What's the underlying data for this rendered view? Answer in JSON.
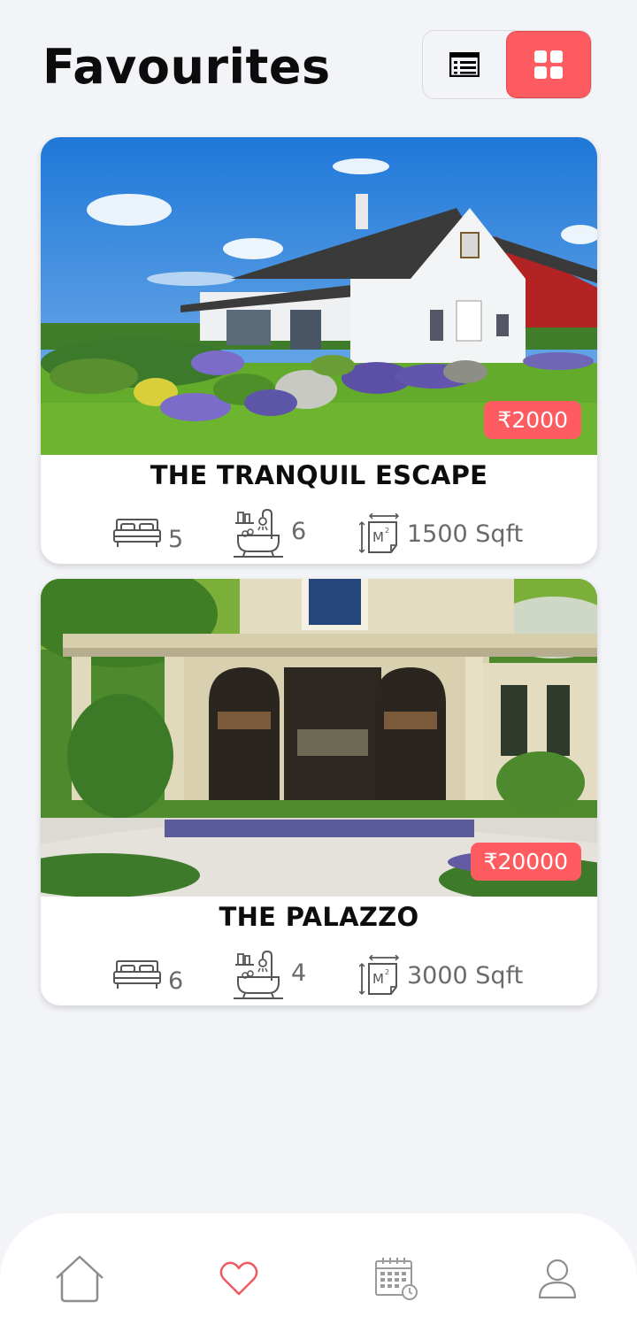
{
  "header": {
    "title": "Favourites",
    "view_toggle": {
      "list_icon": "list-view-icon",
      "grid_icon": "grid-view-icon",
      "active": "grid"
    }
  },
  "properties": [
    {
      "name": "THE TRANQUIL ESCAPE",
      "price": "₹2000",
      "beds": "5",
      "baths": "6",
      "area": "1500 Sqft",
      "image": "white cottage with garden and red barn"
    },
    {
      "name": "THE PALAZZO",
      "price": "₹20000",
      "beds": "6",
      "baths": "4",
      "area": "3000 Sqft",
      "image": "cream villa porch with arched windows and garden"
    }
  ],
  "bottom_nav": {
    "items": [
      {
        "icon": "home-icon",
        "active": false
      },
      {
        "icon": "heart-icon",
        "active": true
      },
      {
        "icon": "calendar-icon",
        "active": false
      },
      {
        "icon": "user-icon",
        "active": false
      }
    ]
  },
  "colors": {
    "accent": "#ff5c61",
    "background": "#f3f4f8",
    "text_muted": "#6a6a6a"
  }
}
